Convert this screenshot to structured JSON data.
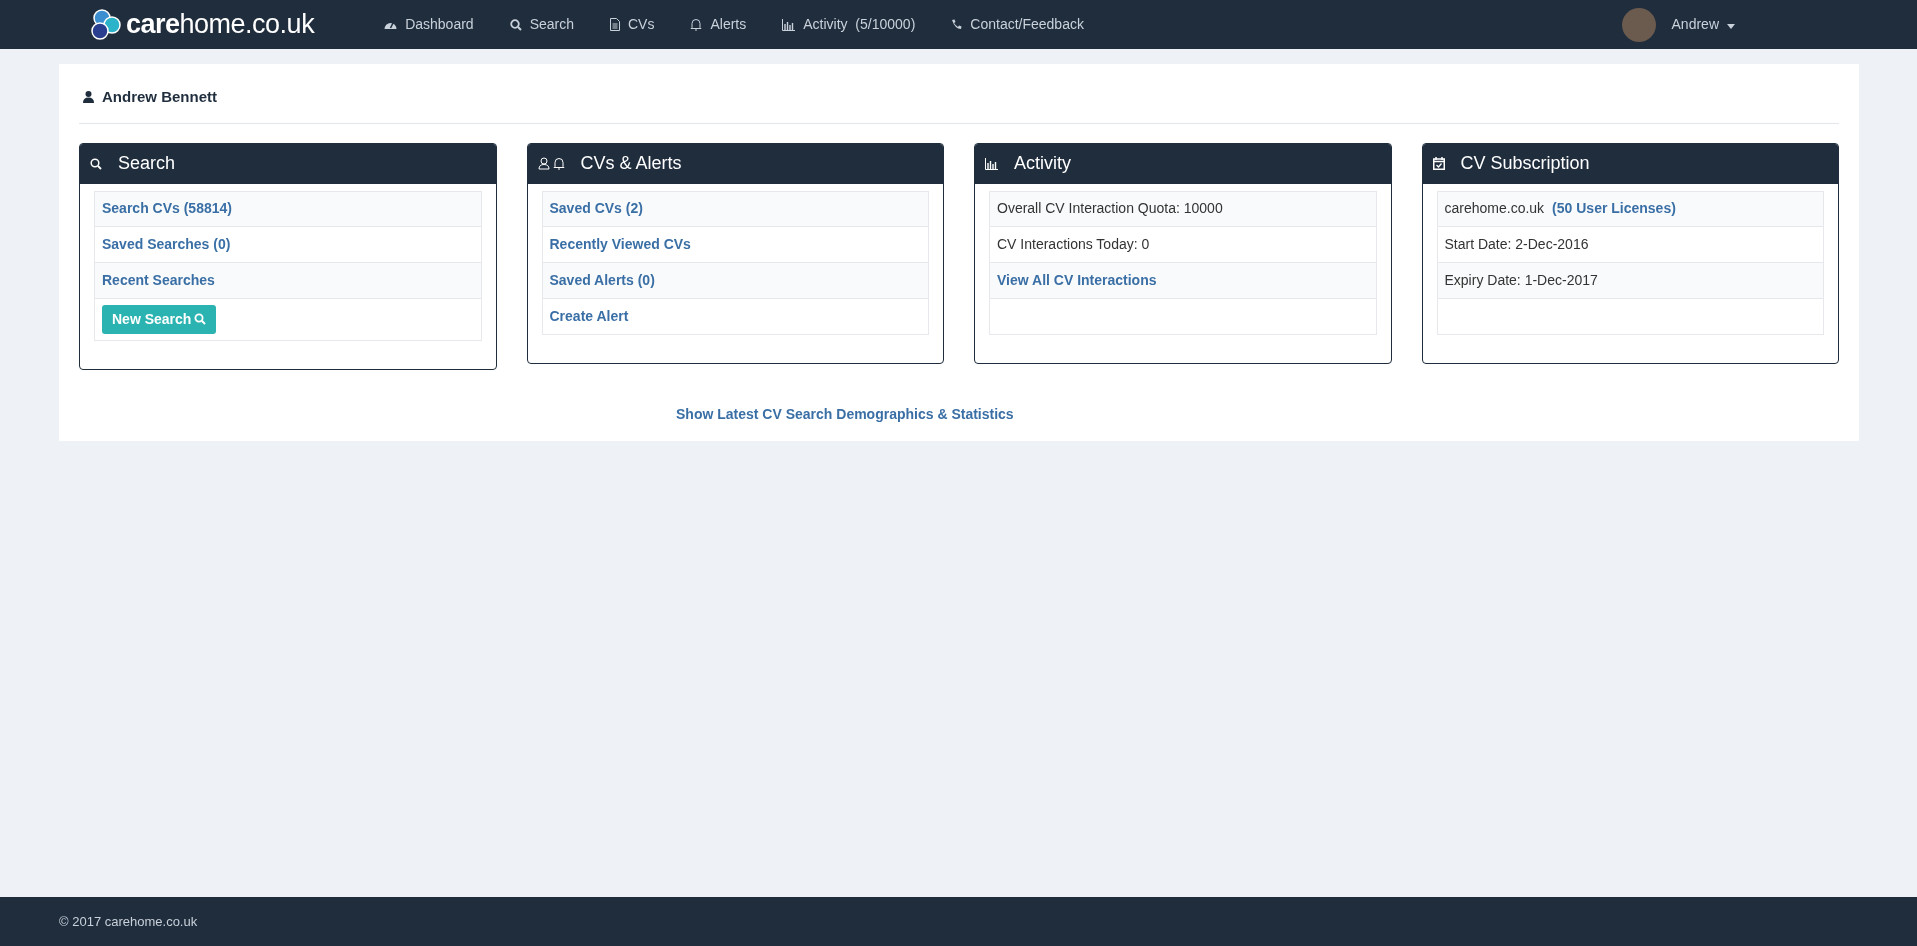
{
  "brand": "**care**home.co.uk",
  "nav": [
    {
      "label": "Dashboard"
    },
    {
      "label": "Search"
    },
    {
      "label": "CVs"
    },
    {
      "label": "Alerts"
    },
    {
      "label": "Activity",
      "count": "(5/10000)"
    },
    {
      "label": "Contact/Feedback"
    }
  ],
  "user": {
    "name": "Andrew"
  },
  "profile": {
    "name": "Andrew Bennett"
  },
  "cards": [
    {
      "title": "Search",
      "items": [
        {
          "kind": "link",
          "text": "Search CVs (58814)"
        },
        {
          "kind": "link",
          "text": "Saved Searches (0)"
        },
        {
          "kind": "link",
          "text": "Recent Searches"
        },
        {
          "kind": "button",
          "text": "New Search"
        }
      ]
    },
    {
      "title": "CVs & Alerts",
      "items": [
        {
          "kind": "link",
          "text": "Saved CVs (2)"
        },
        {
          "kind": "link",
          "text": "Recently Viewed CVs"
        },
        {
          "kind": "link",
          "text": "Saved Alerts (0)"
        },
        {
          "kind": "link",
          "text": "Create Alert"
        }
      ]
    },
    {
      "title": "Activity",
      "items": [
        {
          "kind": "text",
          "text": "Overall CV Interaction Quota: 10000"
        },
        {
          "kind": "text",
          "text": "CV Interactions Today: 0"
        },
        {
          "kind": "link",
          "text": "View All CV Interactions"
        },
        {
          "kind": "blank"
        }
      ]
    },
    {
      "title": "CV Subscription",
      "items": [
        {
          "kind": "text-link",
          "text": "carehome.co.uk",
          "link": "(50 User Licenses)"
        },
        {
          "kind": "text",
          "text": "Start Date: 2-Dec-2016"
        },
        {
          "kind": "text",
          "text": "Expiry Date: 1-Dec-2017"
        },
        {
          "kind": "blank"
        }
      ]
    }
  ],
  "stats_link": "Show Latest CV Search Demographics & Statistics",
  "footer": "© 2017 carehome.co.uk"
}
